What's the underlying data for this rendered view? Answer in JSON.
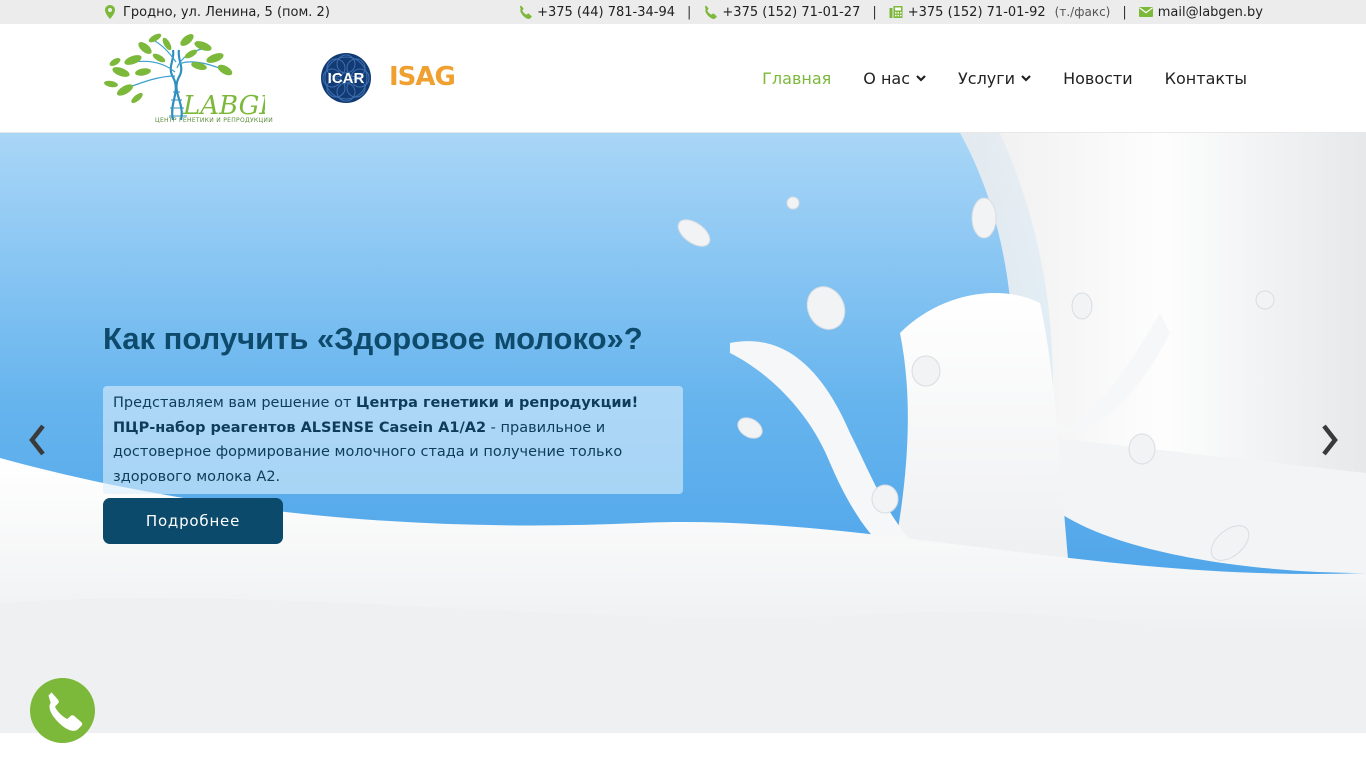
{
  "topbar": {
    "address": "Гродно, ул. Ленина, 5 (пом. 2)",
    "phone1": "+375 (44) 781-34-94",
    "phone2": "+375 (152) 71-01-27",
    "phone3": "+375 (152) 71-01-92",
    "phone3_note": "(т./факс)",
    "email": "mail@labgen.by",
    "separator": "|"
  },
  "header": {
    "logo_text": "LABGEN",
    "logo_caption": "ЦЕНТР ГЕНЕТИКИ И РЕПРОДУКЦИИ",
    "partner1": "ICAR",
    "partner2": "ISAG"
  },
  "nav": [
    {
      "label": "Главная",
      "active": true
    },
    {
      "label": "О нас",
      "dropdown": true
    },
    {
      "label": "Услуги",
      "dropdown": true
    },
    {
      "label": "Новости"
    },
    {
      "label": "Контакты"
    }
  ],
  "hero": {
    "title": "Как получить «Здоровое молоко»?",
    "lead_1": "Представляем вам решение от ",
    "lead_bold": "Центра генетики и репродукции! ПЦР-набор ре­агентов ALSENSE Casein A1/A2",
    "lead_2": " - правильное и достоверное формирование мо­лочного стада и получение только здорового молока А2.",
    "button": "Подробнее"
  },
  "colors": {
    "accent": "#7cb83a",
    "dark_blue": "#0b4a6b",
    "topbar_bg": "#ececec"
  },
  "icons": {
    "address": "map-marker-icon",
    "phone": "phone-icon",
    "fax": "fax-icon",
    "email": "envelope-icon",
    "call": "phone-call-icon"
  }
}
